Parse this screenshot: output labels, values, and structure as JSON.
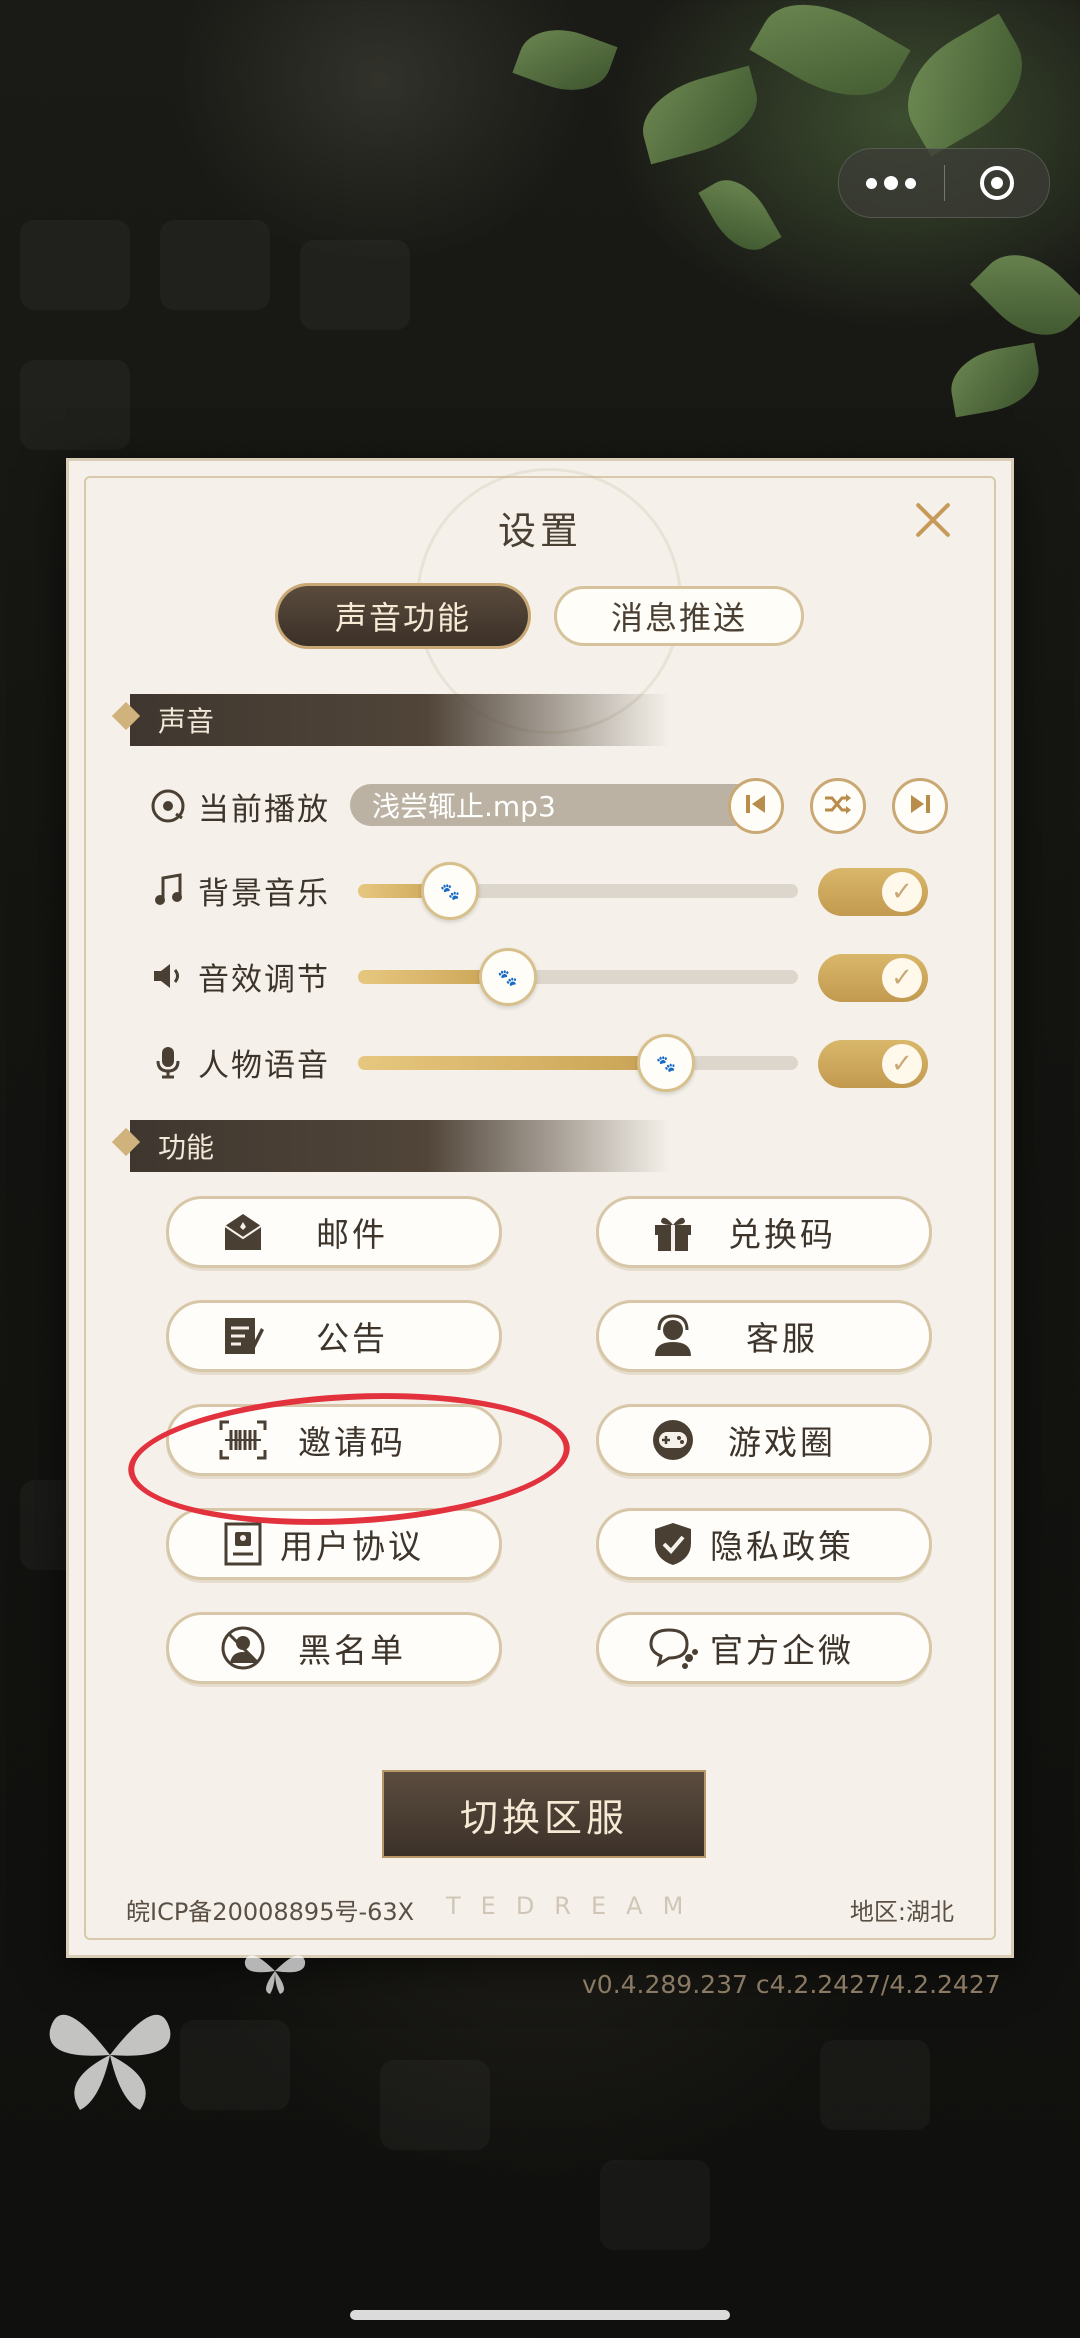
{
  "dialog": {
    "title": "设置",
    "tabs": [
      {
        "label": "声音功能",
        "active": true
      },
      {
        "label": "消息推送",
        "active": false
      }
    ]
  },
  "sound": {
    "section_title": "声音",
    "now_playing_label": "当前播放",
    "track_name": "浅尝辄止.mp3",
    "rows": [
      {
        "label": "背景音乐",
        "icon": "music-note-icon",
        "level": 0.21,
        "enabled": true
      },
      {
        "label": "音效调节",
        "icon": "speaker-icon",
        "level": 0.34,
        "enabled": true
      },
      {
        "label": "人物语音",
        "icon": "microphone-icon",
        "level": 0.7,
        "enabled": true
      }
    ]
  },
  "functions": {
    "section_title": "功能",
    "buttons": [
      {
        "label": "邮件",
        "icon": "mail-icon"
      },
      {
        "label": "兑换码",
        "icon": "gift-icon"
      },
      {
        "label": "公告",
        "icon": "notice-icon"
      },
      {
        "label": "客服",
        "icon": "support-agent-icon"
      },
      {
        "label": "邀请码",
        "icon": "barcode-icon"
      },
      {
        "label": "游戏圈",
        "icon": "gamepad-icon"
      },
      {
        "label": "用户协议",
        "icon": "agreement-icon"
      },
      {
        "label": "隐私政策",
        "icon": "shield-check-icon"
      },
      {
        "label": "黑名单",
        "icon": "blocked-user-icon"
      },
      {
        "label": "官方企微",
        "icon": "chat-bubble-icon"
      }
    ]
  },
  "switch_server_label": "切换区服",
  "footer": {
    "icp": "皖ICP备20008895号-63X",
    "brand_watermark": "TEDREAM",
    "region": "地区:湖北"
  },
  "version": "v0.4.289.237 c4.2.2427/4.2.2427",
  "colors": {
    "accent_gold": "#c9a873",
    "dark_brown": "#3b3028",
    "panel_bg": "#f5f1ea",
    "annotation_red": "#e2323e"
  }
}
